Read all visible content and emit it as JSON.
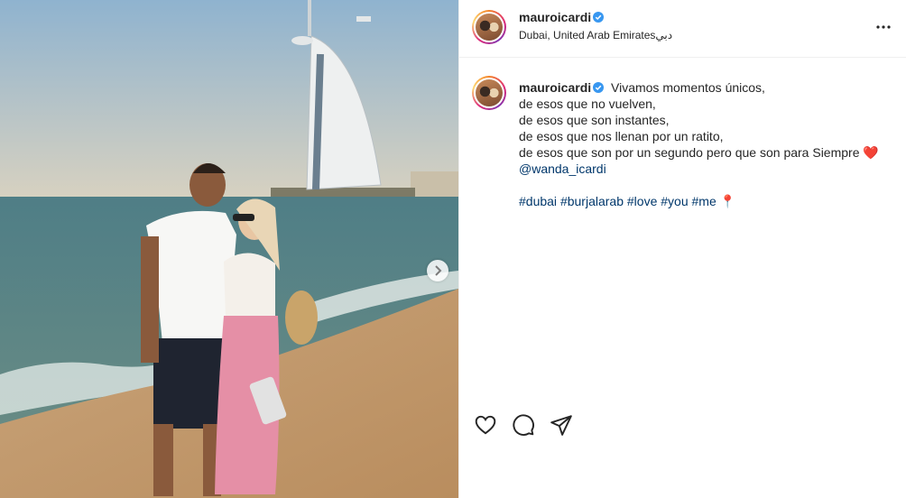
{
  "post": {
    "username": "mauroicardi",
    "location": "Dubai, United Arab Emiratesدبي",
    "caption": {
      "lines": [
        "Vivamos momentos únicos,",
        "de esos que no vuelven,",
        "de esos que son instantes,",
        "de esos que nos llenan por un ratito,",
        "de esos que son por un segundo pero que son para Siempre ❤️"
      ],
      "mention": "@wanda_icardi",
      "hashtags": [
        "#dubai",
        "#burjalarab",
        "#love",
        "#you",
        "#me"
      ],
      "pin": "📍"
    }
  },
  "icons": {
    "verified": "verified-badge-icon",
    "more": "more-options-icon",
    "next": "chevron-right-icon",
    "like": "heart-icon",
    "comment": "comment-icon",
    "share": "share-icon"
  },
  "colors": {
    "link": "#00376b",
    "verified": "#3897f0",
    "text": "#262626",
    "border": "#efefef"
  }
}
